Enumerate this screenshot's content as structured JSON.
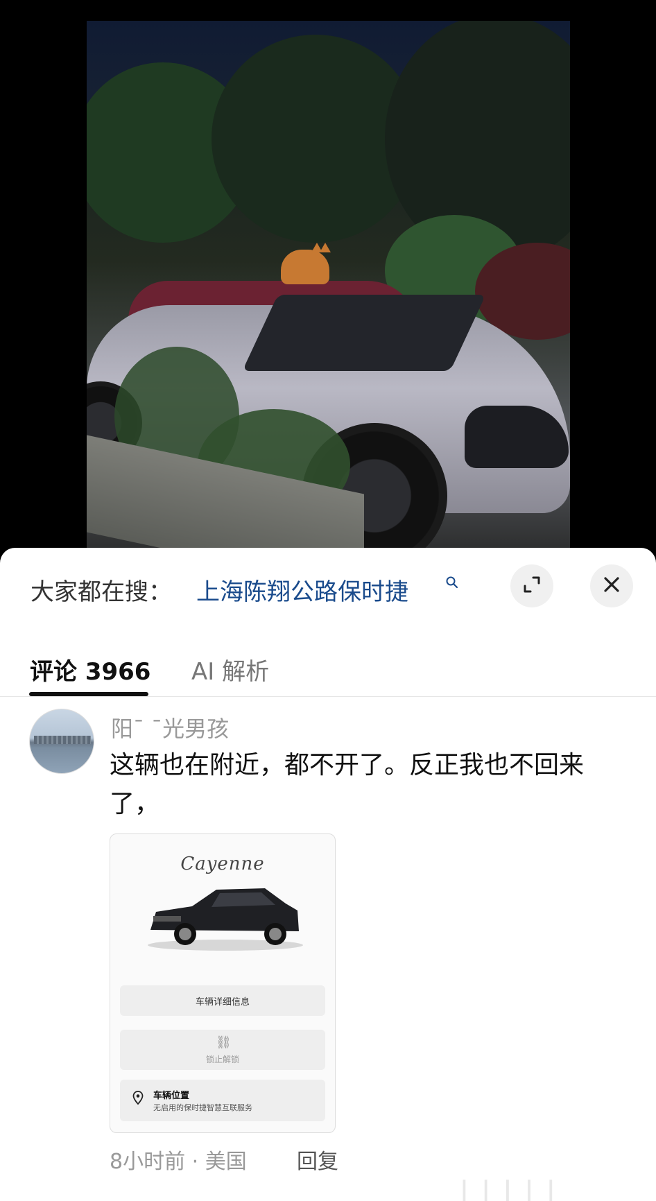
{
  "search_bar": {
    "prefix": "大家都在搜：",
    "term": "上海陈翔公路保时捷",
    "search_icon": "search-icon",
    "expand_icon": "expand-icon",
    "close_icon": "close-icon"
  },
  "tabs": {
    "comments": "评论 3966",
    "ai": "AI 解析"
  },
  "comment": {
    "username": "阳¯ ¯光男孩",
    "text": "这辆也在附近，都不开了。反正我也不回来了，",
    "meta": "8小时前 · 美国",
    "reply_label": "回复",
    "attachment": {
      "brand": "Cayenne",
      "button1": "车辆详细信息",
      "button2": "锁止解锁",
      "location_title": "车辆位置",
      "location_sub": "无启用的保时捷智慧互联服务"
    }
  },
  "watermark": "▏▏▏▏▏"
}
